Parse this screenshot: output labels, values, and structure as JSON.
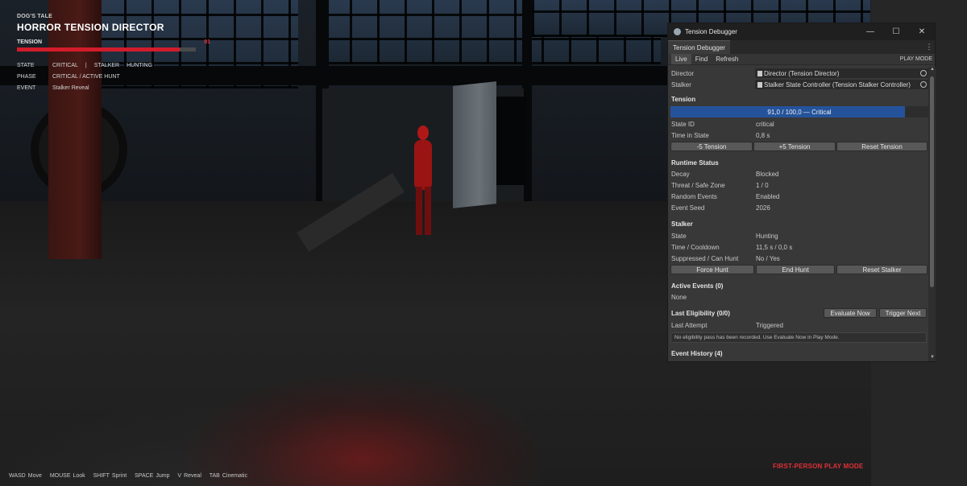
{
  "hud": {
    "game_name": "DOG'S TALE",
    "title": "HORROR TENSION DIRECTOR",
    "tension_label": "TENSION",
    "tension_value": "91",
    "tension_fraction": 0.91,
    "state_key": "STATE",
    "state_value": "CRITICAL",
    "separator": "|",
    "stalker_key": "STALKER",
    "stalker_value": "HUNTING",
    "phase_key": "PHASE",
    "phase_value": "CRITICAL / ACTIVE HUNT",
    "event_key": "EVENT",
    "event_value": "Stalker Reveal",
    "colors": {
      "accent": "#d21c2b",
      "text": "#ffffff"
    }
  },
  "controls": [
    {
      "key": "WASD",
      "action": "Move"
    },
    {
      "key": "MOUSE",
      "action": "Look"
    },
    {
      "key": "SHIFT",
      "action": "Sprint"
    },
    {
      "key": "SPACE",
      "action": "Jump"
    },
    {
      "key": "V",
      "action": "Reveal"
    },
    {
      "key": "TAB",
      "action": "Cinematic"
    }
  ],
  "mode_banner": "FIRST-PERSON PLAY MODE",
  "debugger": {
    "window_title": "Tension Debugger",
    "tab_label": "Tension Debugger",
    "icons": {
      "minimize": "minimize-icon",
      "maximize": "maximize-icon",
      "close": "close-icon",
      "menu": "kebab-menu-icon"
    },
    "toolbar": {
      "live": "Live",
      "find": "Find",
      "refresh": "Refresh",
      "play_mode": "PLAY MODE"
    },
    "director_label": "Director",
    "director_value": "Director (Tension Director)",
    "stalker_label": "Stalker",
    "stalker_value": "Stalker State Controller (Tension Stalker Controller)",
    "tension": {
      "header": "Tension",
      "bar_text": "91,0 / 100,0  —  Critical",
      "fraction": 0.91,
      "bar_color": "#24539b",
      "state_id_label": "State ID",
      "state_id_value": "critical",
      "time_label": "Time in State",
      "time_value": "0,8 s",
      "btn_minus": "-5 Tension",
      "btn_plus": "+5 Tension",
      "btn_reset": "Reset Tension"
    },
    "runtime": {
      "header": "Runtime Status",
      "decay_label": "Decay",
      "decay_value": "Blocked",
      "threat_label": "Threat / Safe Zone",
      "threat_value": "1 / 0",
      "random_label": "Random Events",
      "random_value": "Enabled",
      "seed_label": "Event Seed",
      "seed_value": "2026"
    },
    "stalker": {
      "header": "Stalker",
      "state_label": "State",
      "state_value": "Hunting",
      "cooldown_label": "Time / Cooldown",
      "cooldown_value": "11,5 s / 0,0 s",
      "suppressed_label": "Suppressed / Can Hunt",
      "suppressed_value": "No / Yes",
      "btn_force": "Force Hunt",
      "btn_end": "End Hunt",
      "btn_reset": "Reset Stalker"
    },
    "active_events": {
      "header": "Active Events (0)",
      "none": "None"
    },
    "eligibility": {
      "header": "Last Eligibility (0/0)",
      "btn_evaluate": "Evaluate Now",
      "btn_trigger": "Trigger Next",
      "attempt_label": "Last Attempt",
      "attempt_value": "Triggered",
      "help": "No eligibility pass has been recorded. Use Evaluate Now in Play Mode."
    },
    "history": {
      "header": "Event History (4)"
    }
  }
}
